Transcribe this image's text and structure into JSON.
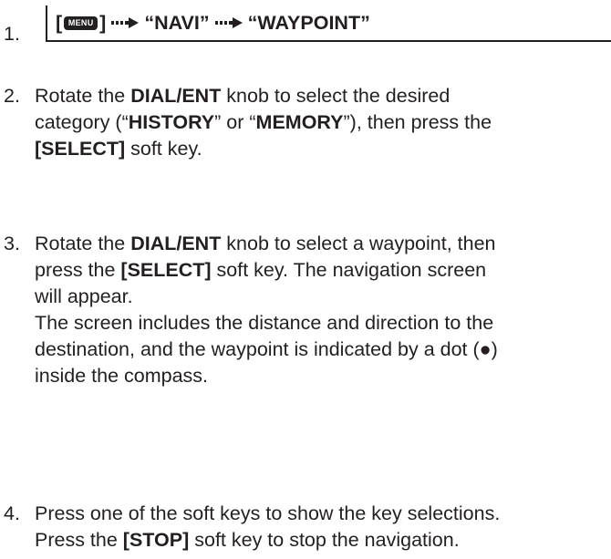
{
  "steps": [
    {
      "number": "1.",
      "path": {
        "bracket_open": "[",
        "menu_key": "MENU",
        "bracket_close": "]",
        "item1": "“NAVI”",
        "item2": "“WAYPOINT”"
      }
    },
    {
      "number": "2.",
      "lines": [
        [
          "Rotate the ",
          {
            "b": "DIAL/ENT"
          },
          " knob to select the desired"
        ],
        [
          "category (“",
          {
            "b": "HISTORY"
          },
          "” or “",
          {
            "b": "MEMORY"
          },
          "”), then press the"
        ],
        [
          {
            "b": "[SELECT]"
          },
          " soft key."
        ]
      ]
    },
    {
      "number": "3.",
      "lines": [
        [
          "Rotate the ",
          {
            "b": "DIAL/ENT"
          },
          " knob to select a waypoint, then"
        ],
        [
          "press the ",
          {
            "b": "[SELECT]"
          },
          " soft key. The navigation screen"
        ],
        [
          "will appear."
        ],
        [
          "The screen includes the distance and direction to the"
        ],
        [
          "destination, and the waypoint is indicated by a dot (●)"
        ],
        [
          "inside the compass."
        ]
      ]
    },
    {
      "number": "4.",
      "lines": [
        [
          "Press one of the soft keys to show the key selections."
        ],
        [
          "Press the ",
          {
            "b": "[STOP]"
          },
          " soft key to stop the navigation."
        ]
      ]
    }
  ]
}
